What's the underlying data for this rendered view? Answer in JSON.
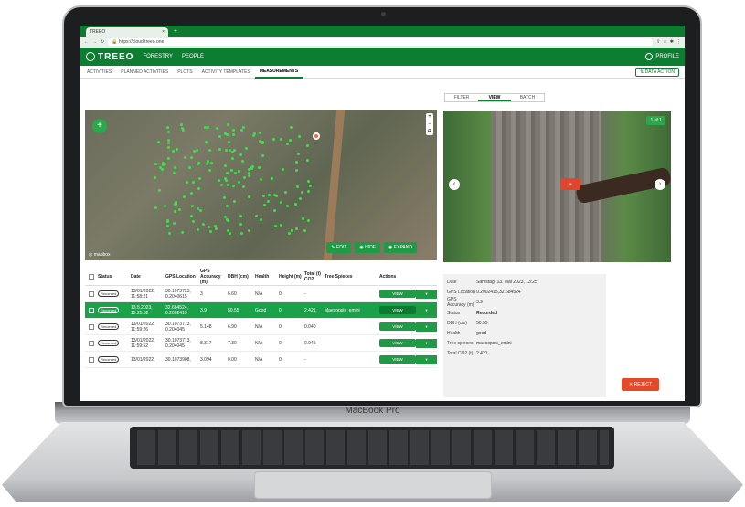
{
  "device": {
    "brand": "MacBook Pro"
  },
  "browser": {
    "tab_title": "TREEO",
    "tab_close": "×",
    "new_tab": "+",
    "url": "https://cloud.treeo.one"
  },
  "app": {
    "logo": "TREEO",
    "nav": [
      "FORESTRY",
      "PEOPLE"
    ],
    "profile_label": "PROFILE",
    "subtabs": [
      "ACTIVITIES",
      "PLANNED ACTIVITIES",
      "PLOTS",
      "ACTIVITY TEMPLATES",
      "MEASUREMENTS"
    ],
    "active_subtab": "MEASUREMENTS",
    "data_action": "DATA ACTION"
  },
  "map": {
    "zoom_in": "+",
    "zoom_out": "−",
    "locate": "⊕",
    "add_button": "+",
    "buttons": {
      "edit": "EDIT",
      "hide": "HIDE",
      "expand": "EXPAND"
    },
    "attribution": "mapbox"
  },
  "table": {
    "headers": [
      "",
      "Status",
      "Date",
      "GPS Location",
      "GPS Accuracy (m)",
      "DBH (cm)",
      "Health",
      "Height (m)",
      "Total (t) CO2",
      "Tree Spieces",
      "Actions"
    ],
    "rows": [
      {
        "status": "Recorded",
        "date": "13/01/2022, 11:58:21",
        "gps": "30.1073723, 0.2040615",
        "acc": "3",
        "dbh": "6.60",
        "health": "N/A",
        "height": "0",
        "co2": "-",
        "species": "",
        "selected": false
      },
      {
        "status": "Recorded",
        "date": "13.5.2023, 13:25:52",
        "gps": "32.684524, 0.2002415",
        "acc": "3.9",
        "dbh": "50.55",
        "health": "Good",
        "height": "0",
        "co2": "2.421",
        "species": "Maesopsis_emini",
        "selected": true
      },
      {
        "status": "Recorded",
        "date": "13/01/2022, 11:59:26",
        "gps": "30.1073713, 0.204045",
        "acc": "5.148",
        "dbh": "6.90",
        "health": "N/A",
        "height": "0",
        "co2": "0.040",
        "species": "",
        "selected": false
      },
      {
        "status": "Recorded",
        "date": "13/01/2022, 11:59:52",
        "gps": "30.1073713, 0.204045",
        "acc": "8.317",
        "dbh": "7.30",
        "health": "N/A",
        "height": "0",
        "co2": "0.045",
        "species": "",
        "selected": false
      },
      {
        "status": "Recorded",
        "date": "13/01/2022,",
        "gps": "30.1073908,",
        "acc": "3.094",
        "dbh": "0.00",
        "health": "N/A",
        "height": "0",
        "co2": "-",
        "species": "",
        "selected": false
      }
    ],
    "view_label": "VIEW",
    "caret": "▾"
  },
  "panel": {
    "tabs": [
      "FILTER",
      "VIEW",
      "BATCH"
    ],
    "active_tab": "VIEW",
    "counter": "1 of 1",
    "prev": "‹",
    "next": "›",
    "details": [
      {
        "k": "Date",
        "v": "Samstag, 13. Mai 2023, 13:25",
        "bold": false
      },
      {
        "k": "GPS Location",
        "v": "0.2002415,32.684524",
        "bold": false
      },
      {
        "k": "GPS Accuracy (m)",
        "v": "3.9",
        "bold": false
      },
      {
        "k": "Status",
        "v": "Recorded",
        "bold": true
      },
      {
        "k": "DBH (cm)",
        "v": "50.55",
        "bold": false
      },
      {
        "k": "Health",
        "v": "good",
        "bold": false
      },
      {
        "k": "Tree spieces",
        "v": "maesopsis_emini",
        "bold": false
      },
      {
        "k": "Total CO2 (t)",
        "v": "2.421",
        "bold": false
      }
    ],
    "reject": "REJECT"
  },
  "colors": {
    "primary": "#0c7d31",
    "accent": "#1aa14a",
    "reject": "#e44a2a"
  }
}
